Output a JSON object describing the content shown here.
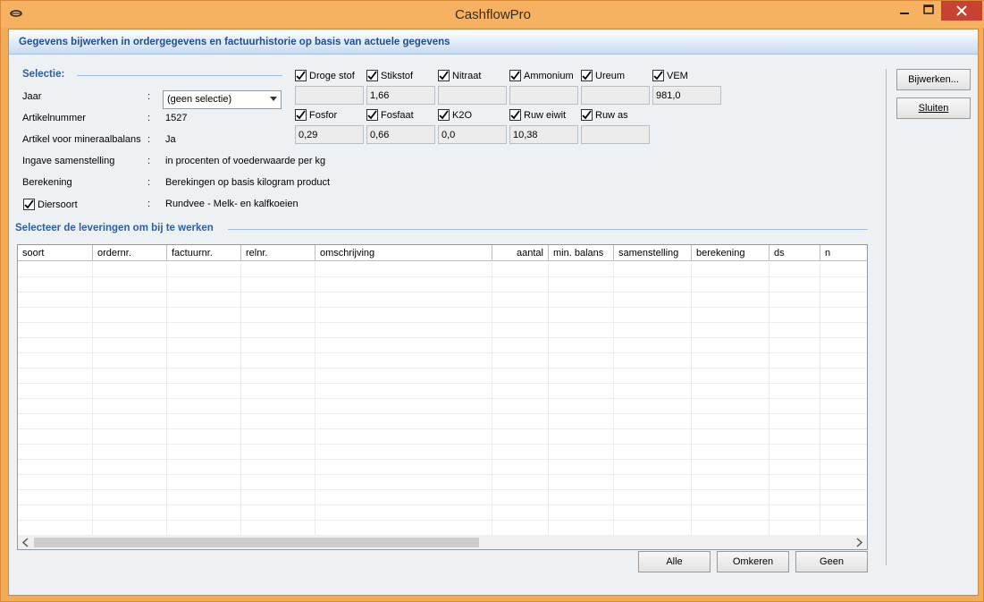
{
  "window": {
    "title": "CashflowPro"
  },
  "header": {
    "title": "Gegevens bijwerken in ordergegevens en factuurhistorie op basis van actuele gegevens"
  },
  "selection": {
    "title": "Selectie:",
    "rows": [
      {
        "label": "Jaar",
        "colon": ":",
        "value": "(geen selectie)"
      },
      {
        "label": "Artikelnummer",
        "colon": ":",
        "value": "1527"
      },
      {
        "label": "Artikel voor mineraalbalans",
        "colon": ":",
        "value": "Ja"
      },
      {
        "label": "Ingave samenstelling",
        "colon": ":",
        "value": "in procenten of voederwaarde per kg"
      },
      {
        "label": "Berekening",
        "colon": ":",
        "value": "Berekingen op basis kilogram product"
      },
      {
        "label": "Diersoort",
        "colon": ":",
        "value": "Rundvee - Melk- en kalfkoeien",
        "checked": true
      }
    ]
  },
  "nutrients": [
    {
      "label": "Droge stof",
      "checked": true,
      "value": ""
    },
    {
      "label": "Stikstof",
      "checked": true,
      "value": "1,66"
    },
    {
      "label": "Nitraat",
      "checked": true,
      "value": ""
    },
    {
      "label": "Ammonium",
      "checked": true,
      "value": ""
    },
    {
      "label": "Ureum",
      "checked": true,
      "value": ""
    },
    {
      "label": "VEM",
      "checked": true,
      "value": "981,0"
    },
    {
      "label": "Fosfor",
      "checked": true,
      "value": "0,29"
    },
    {
      "label": "Fosfaat",
      "checked": true,
      "value": "0,66"
    },
    {
      "label": "K2O",
      "checked": true,
      "value": "0,0"
    },
    {
      "label": "Ruw eiwit",
      "checked": true,
      "value": "10,38"
    },
    {
      "label": "Ruw as",
      "checked": true,
      "value": ""
    }
  ],
  "deliveries": {
    "title": "Selecteer de leveringen om bij te werken",
    "columns": [
      "soort",
      "ordernr.",
      "factuurnr.",
      "relnr.",
      "omschrijving",
      "aantal",
      "min. balans",
      "samenstelling",
      "berekening",
      "ds",
      "n"
    ],
    "rows": []
  },
  "buttons": {
    "update": "Bijwerken...",
    "close": "Sluiten",
    "all": "Alle",
    "invert": "Omkeren",
    "none": "Geen"
  }
}
